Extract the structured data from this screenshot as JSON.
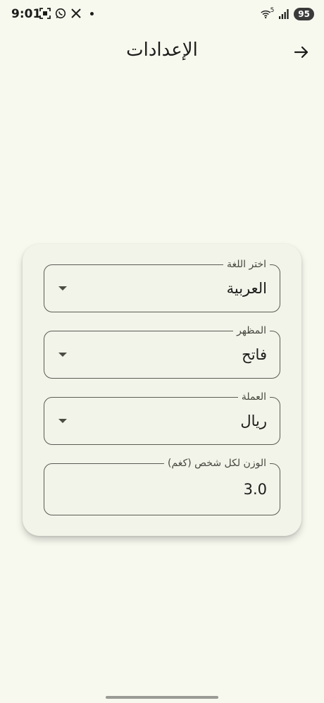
{
  "status_bar": {
    "time": "9:01",
    "battery": "95",
    "wifi_label": "5"
  },
  "app_bar": {
    "title": "الإعدادات"
  },
  "settings": {
    "language": {
      "label": "اختر اللغة",
      "value": "العربية"
    },
    "theme": {
      "label": "المظهر",
      "value": "فاتح"
    },
    "currency": {
      "label": "العملة",
      "value": "ريال"
    },
    "weight": {
      "label": "الوزن لكل شخص (كغم)",
      "value": "3.0"
    }
  },
  "icons": {
    "back": "arrow-right-icon",
    "dropdown": "caret-down-icon"
  }
}
